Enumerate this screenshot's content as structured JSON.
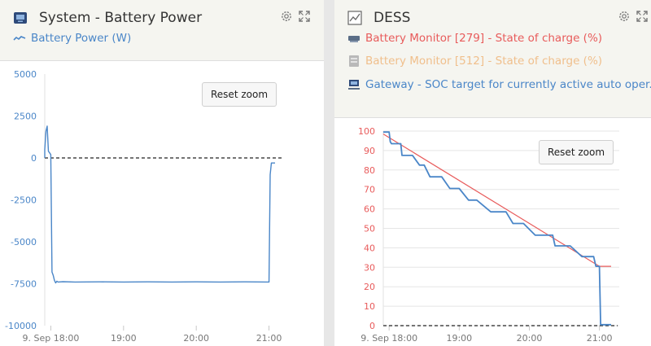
{
  "colors": {
    "battery_power": "#4a86c8",
    "soc_279": "#e85b5b",
    "soc_512": "#f0bf8c",
    "soc_target": "#4a86c8",
    "tick_left": "#4a86c8",
    "tick_right": "#e85b5b",
    "zero_line": "#222222",
    "grid": "#e5e5e5"
  },
  "left": {
    "title": "System - Battery Power",
    "legend": [
      {
        "label": "Battery Power (W)",
        "icon": "battery-power-line-icon"
      }
    ],
    "reset_label": "Reset zoom",
    "settings_icon": "gear-icon",
    "expand_icon": "expand-icon",
    "title_icon": "system-device-icon"
  },
  "right": {
    "title": "DESS",
    "legend": [
      {
        "label": "Battery Monitor [279] - State of charge (%)",
        "icon": "battery-monitor-icon"
      },
      {
        "label": "Battery Monitor [512] - State of charge (%)",
        "icon": "battery-monitor-icon"
      },
      {
        "label": "Gateway - SOC target for currently active auto oper...",
        "icon": "gateway-icon"
      }
    ],
    "reset_label": "Reset zoom",
    "settings_icon": "gear-icon",
    "expand_icon": "expand-icon",
    "title_icon": "chart-icon"
  },
  "chart_data": [
    {
      "type": "line",
      "title": "System - Battery Power",
      "xlabel": "",
      "ylabel": "",
      "x_ticks": [
        "9. Sep 18:00",
        "19:00",
        "20:00",
        "21:00"
      ],
      "x_range": [
        "17:55",
        "21:05"
      ],
      "y_ticks": [
        5000,
        2500,
        0,
        -2500,
        -5000,
        -7500,
        -10000
      ],
      "ylim": [
        -10000,
        5000
      ],
      "grid": false,
      "reference_lines": [
        {
          "y": 0,
          "style": "dashed"
        }
      ],
      "series": [
        {
          "name": "Battery Power (W)",
          "points": [
            [
              "17:55",
              0
            ],
            [
              "17:55",
              500
            ],
            [
              "17:56",
              1600
            ],
            [
              "17:57",
              1900
            ],
            [
              "17:57",
              1850
            ],
            [
              "17:58",
              400
            ],
            [
              "17:59",
              300
            ],
            [
              "18:00",
              200
            ],
            [
              "18:01",
              -6800
            ],
            [
              "18:02",
              -7000
            ],
            [
              "18:03",
              -7300
            ],
            [
              "18:04",
              -7450
            ],
            [
              "18:05",
              -7350
            ],
            [
              "18:06",
              -7400
            ],
            [
              "18:10",
              -7380
            ],
            [
              "18:20",
              -7400
            ],
            [
              "18:40",
              -7390
            ],
            [
              "19:00",
              -7400
            ],
            [
              "19:20",
              -7390
            ],
            [
              "19:40",
              -7400
            ],
            [
              "20:00",
              -7390
            ],
            [
              "20:20",
              -7400
            ],
            [
              "20:40",
              -7390
            ],
            [
              "21:00",
              -7400
            ],
            [
              "21:00",
              -7350
            ],
            [
              "21:01",
              -1000
            ],
            [
              "21:02",
              -300
            ],
            [
              "21:05",
              -300
            ]
          ]
        }
      ]
    },
    {
      "type": "line",
      "title": "DESS",
      "xlabel": "",
      "ylabel": "",
      "x_ticks": [
        "9. Sep 18:00",
        "19:00",
        "20:00",
        "21:00"
      ],
      "x_range": [
        "17:55",
        "21:10"
      ],
      "y_ticks": [
        100,
        90,
        80,
        70,
        60,
        50,
        40,
        30,
        20,
        10,
        0
      ],
      "ylim": [
        0,
        100
      ],
      "grid": true,
      "reference_lines": [
        {
          "y": 0,
          "style": "dashed"
        }
      ],
      "series": [
        {
          "name": "Battery Monitor [279] - State of charge (%)",
          "points": [
            [
              "17:55",
              98.5
            ],
            [
              "21:00",
              30.5
            ],
            [
              "21:10",
              30.5
            ]
          ]
        },
        {
          "name": "Battery Monitor [512] - State of charge (%)",
          "points": []
        },
        {
          "name": "Gateway - SOC target for currently active auto oper...",
          "step": true,
          "points": [
            [
              "17:55",
              99.5
            ],
            [
              "18:00",
              99.5
            ],
            [
              "18:01",
              94.5
            ],
            [
              "18:02",
              93.5
            ],
            [
              "18:10",
              93.5
            ],
            [
              "18:11",
              87.5
            ],
            [
              "18:20",
              87.5
            ],
            [
              "18:26",
              82.5
            ],
            [
              "18:30",
              82.5
            ],
            [
              "18:35",
              76.5
            ],
            [
              "18:45",
              76.5
            ],
            [
              "18:52",
              70.5
            ],
            [
              "19:00",
              70.5
            ],
            [
              "19:08",
              64.5
            ],
            [
              "19:15",
              64.5
            ],
            [
              "19:27",
              58.5
            ],
            [
              "19:40",
              58.5
            ],
            [
              "19:46",
              52.5
            ],
            [
              "19:55",
              52.5
            ],
            [
              "20:05",
              46.5
            ],
            [
              "20:20",
              46.5
            ],
            [
              "20:22",
              41
            ],
            [
              "20:35",
              41
            ],
            [
              "20:45",
              35.5
            ],
            [
              "20:55",
              35.5
            ],
            [
              "20:57",
              30.5
            ],
            [
              "21:00",
              30.5
            ],
            [
              "21:01",
              0.5
            ],
            [
              "21:10",
              0.5
            ]
          ]
        }
      ]
    }
  ]
}
